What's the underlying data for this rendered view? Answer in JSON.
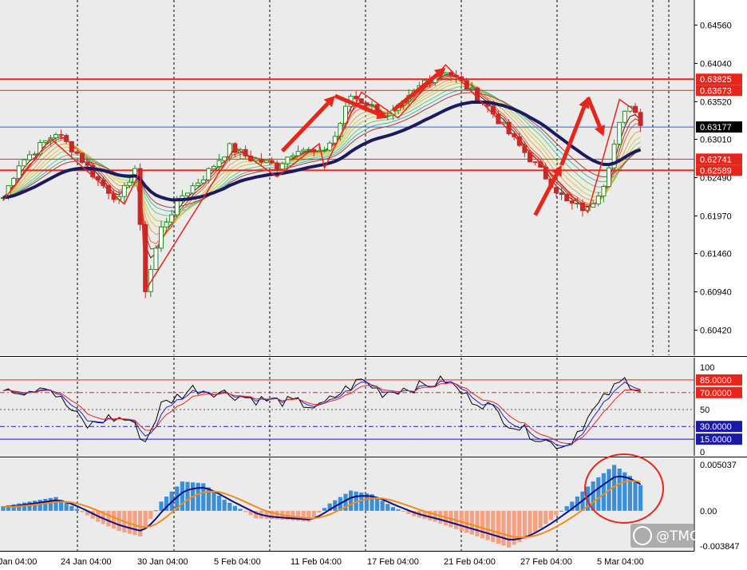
{
  "chart_data": [
    {
      "type": "candlestick",
      "panel": "price",
      "y_ticks": [
        "0.64560",
        "0.64040",
        "0.63520",
        "0.63010",
        "0.62490",
        "0.61970",
        "0.61460",
        "0.60940",
        "0.60420"
      ],
      "ylim": [
        0.6008,
        0.649
      ],
      "levels": [
        {
          "value": 0.63825,
          "label": "0.63825",
          "color": "#e8251b"
        },
        {
          "value": 0.63673,
          "label": "0.63673",
          "color": "#e8251b"
        },
        {
          "value": 0.63177,
          "label": "0.63177",
          "color": "#000000"
        },
        {
          "value": 0.62741,
          "label": "0.62741",
          "color": "#e8251b"
        },
        {
          "value": 0.62589,
          "label": "0.62589",
          "color": "#e8251b"
        }
      ],
      "zigzag": [
        [
          0,
          0.6218
        ],
        [
          9,
          0.6302
        ],
        [
          23,
          0.6213
        ],
        [
          26,
          0.6258
        ],
        [
          27,
          0.6096
        ],
        [
          44,
          0.629
        ],
        [
          52,
          0.625
        ],
        [
          60,
          0.6295
        ],
        [
          61,
          0.6262
        ],
        [
          68,
          0.6365
        ],
        [
          75,
          0.633
        ],
        [
          84,
          0.6402
        ],
        [
          111,
          0.6202
        ],
        [
          117,
          0.6355
        ],
        [
          120,
          0.634
        ]
      ],
      "arrows": [
        [
          [
            53,
            0.6285
          ],
          [
            63,
            0.636
          ]
        ],
        [
          [
            63,
            0.636
          ],
          [
            73,
            0.633
          ]
        ],
        [
          [
            74,
            0.634
          ],
          [
            84,
            0.6398
          ]
        ],
        [
          [
            101,
            0.6198
          ],
          [
            106,
            0.6266
          ]
        ],
        [
          [
            106,
            0.6266
          ],
          [
            111,
            0.6358
          ]
        ],
        [
          [
            111,
            0.6358
          ],
          [
            114,
            0.6305
          ]
        ]
      ]
    },
    {
      "type": "line",
      "panel": "oscillator",
      "y_ticks": [
        "100",
        "50",
        "0"
      ],
      "ylim": [
        0,
        100
      ],
      "levels": [
        {
          "value": 85,
          "label": "85.0000",
          "color": "#e8251b"
        },
        {
          "value": 70,
          "label": "70.0000",
          "color": "#e8251b"
        },
        {
          "value": 30,
          "label": "30.0000",
          "color": "#1a1aa6"
        },
        {
          "value": 15,
          "label": "15.0000",
          "color": "#1a1aa6"
        }
      ]
    },
    {
      "type": "bar",
      "panel": "macd",
      "y_ticks": [
        "0.005037",
        "0.00",
        "-0.003847"
      ],
      "ylim": [
        -0.003847,
        0.005037
      ]
    }
  ],
  "x_axis": {
    "labels": [
      "Jan 04:00",
      "24 Jan 04:00",
      "30 Jan 04:00",
      "5 Feb 04:00",
      "11 Feb 04:00",
      "17 Feb 04:00",
      "21 Feb 04:00",
      "27 Feb 04:00",
      "5 Mar 04:00"
    ]
  },
  "watermark": "@TMGM",
  "colors": {
    "background": "#ebebeb",
    "bull": "#1b8e1b",
    "bear": "#c62828",
    "ma_slow": "#1c1a5e",
    "histogram_pos": "#3a8fd6",
    "histogram_neg": "#f4a183",
    "signal": "#f08c18",
    "annotation": "#e8251b"
  }
}
